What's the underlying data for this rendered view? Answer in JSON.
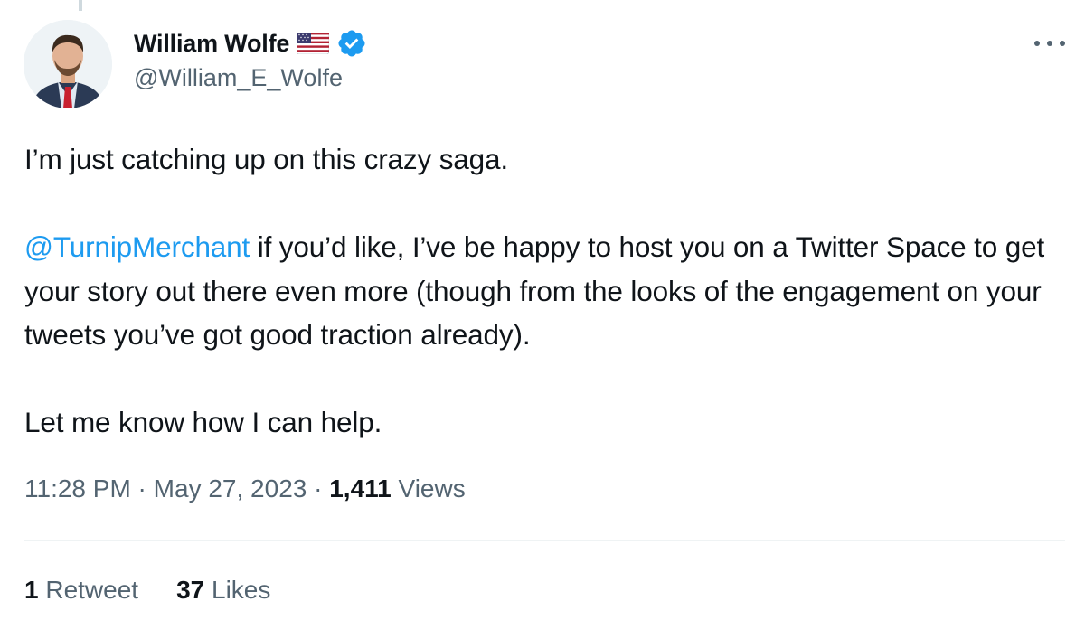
{
  "author": {
    "display_name": "William Wolfe",
    "handle": "@William_E_Wolfe",
    "flag_icon": "us-flag-icon",
    "verified_icon": "verified-badge-icon",
    "verified_color": "#1d9bf0"
  },
  "menu": {
    "more_icon": "more-options-icon"
  },
  "tweet": {
    "line1": "I’m just catching up on this crazy saga.",
    "mention": "@TurnipMerchant",
    "line2_rest": " if you’d like, I’ve be happy to host you on a Twitter Space to get your story out there even more (though from the looks of the engagement on your tweets you’ve got good traction already).",
    "line3": "Let me know how I can help.",
    "mention_color": "#1d9bf0"
  },
  "meta": {
    "time": "11:28 PM",
    "separator": " · ",
    "date": "May 27, 2023",
    "views_count": "1,411",
    "views_label": " Views"
  },
  "stats": {
    "retweets_count": "1",
    "retweets_label": " Retweet",
    "likes_count": "37",
    "likes_label": " Likes"
  }
}
